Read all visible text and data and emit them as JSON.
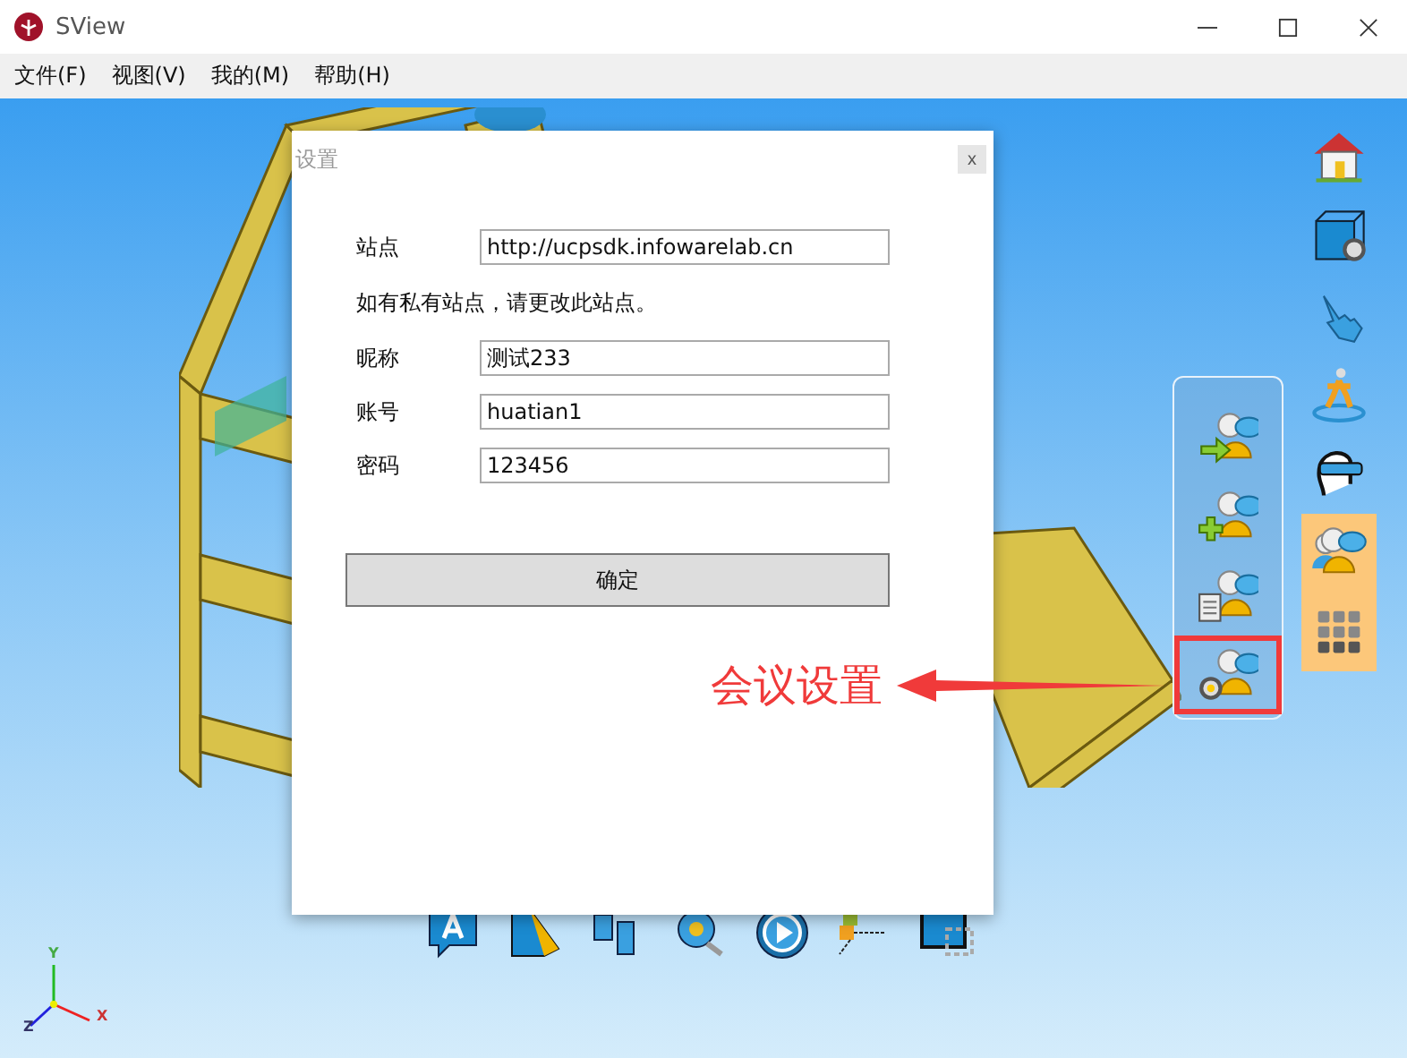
{
  "window": {
    "title": "SView"
  },
  "menu": [
    "文件(F)",
    "视图(V)",
    "我的(M)",
    "帮助(H)"
  ],
  "dialog": {
    "title": "设置",
    "close": "x",
    "fields": [
      {
        "kind": "field",
        "label": "站点",
        "value": "http://ucpsdk.infowarelab.cn"
      },
      {
        "kind": "note",
        "text": "如有私有站点，请更改此站点。"
      },
      {
        "kind": "field",
        "label": "昵称",
        "value": "测试233"
      },
      {
        "kind": "field",
        "label": "账号",
        "value": "huatian1"
      },
      {
        "kind": "field",
        "label": "密码",
        "value": "123456"
      }
    ],
    "button": "确定"
  },
  "toolbar": [
    {
      "selected": false
    },
    {
      "selected": false
    },
    {
      "selected": false
    },
    {
      "selected": false
    },
    {
      "selected": false
    },
    {
      "selected": true
    },
    {
      "selected": true
    }
  ],
  "submenu": [
    {
      "marked": false
    },
    {
      "marked": false
    },
    {
      "marked": false
    },
    {
      "marked": true
    }
  ],
  "annotation": {
    "label": "会议设置"
  },
  "axes": {
    "x": "X",
    "y": "Y",
    "z": "Z"
  }
}
